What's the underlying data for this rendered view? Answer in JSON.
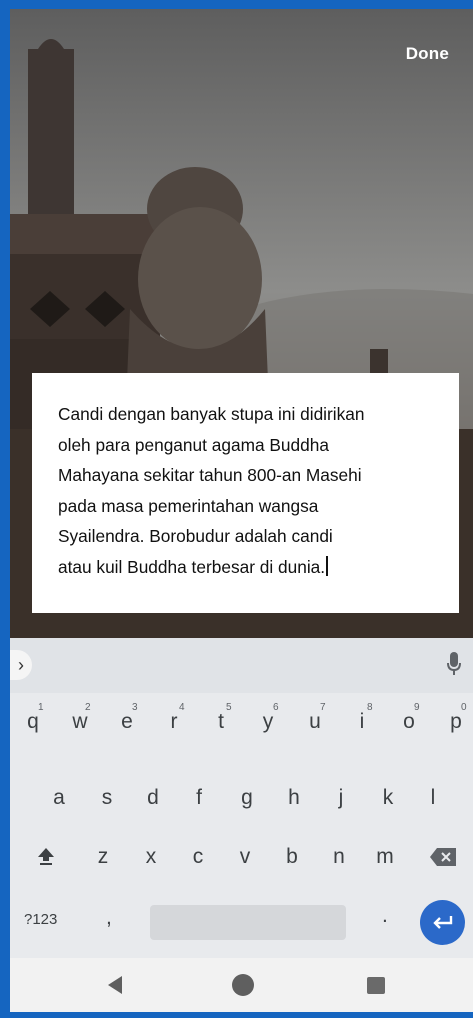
{
  "header": {
    "done_label": "Done"
  },
  "caption": {
    "text": "Candi dengan banyak stupa ini didirikan\noleh para penganut agama Buddha\nMahayana sekitar tahun 800-an Masehi\npada masa pemerintahan wangsa\nSyailendra. Borobudur adalah candi\natau kuil Buddha terbesar di dunia."
  },
  "keyboard": {
    "expand_glyph": "›",
    "row1": [
      {
        "char": "q",
        "hint": "1"
      },
      {
        "char": "w",
        "hint": "2"
      },
      {
        "char": "e",
        "hint": "3"
      },
      {
        "char": "r",
        "hint": "4"
      },
      {
        "char": "t",
        "hint": "5"
      },
      {
        "char": "y",
        "hint": "6"
      },
      {
        "char": "u",
        "hint": "7"
      },
      {
        "char": "i",
        "hint": "8"
      },
      {
        "char": "o",
        "hint": "9"
      },
      {
        "char": "p",
        "hint": "0"
      }
    ],
    "row2": [
      "a",
      "s",
      "d",
      "f",
      "g",
      "h",
      "j",
      "k",
      "l"
    ],
    "row3": [
      "z",
      "x",
      "c",
      "v",
      "b",
      "n",
      "m"
    ],
    "symbols_label": "?123",
    "comma_label": ",",
    "period_label": ".",
    "accent_color": "#2b69c9"
  },
  "icons": {
    "mic": "microphone-icon",
    "shift": "shift-icon",
    "backspace": "backspace-icon",
    "enter": "enter-icon",
    "nav_back": "back-triangle-icon",
    "nav_home": "home-circle-icon",
    "nav_recent": "recent-square-icon"
  }
}
